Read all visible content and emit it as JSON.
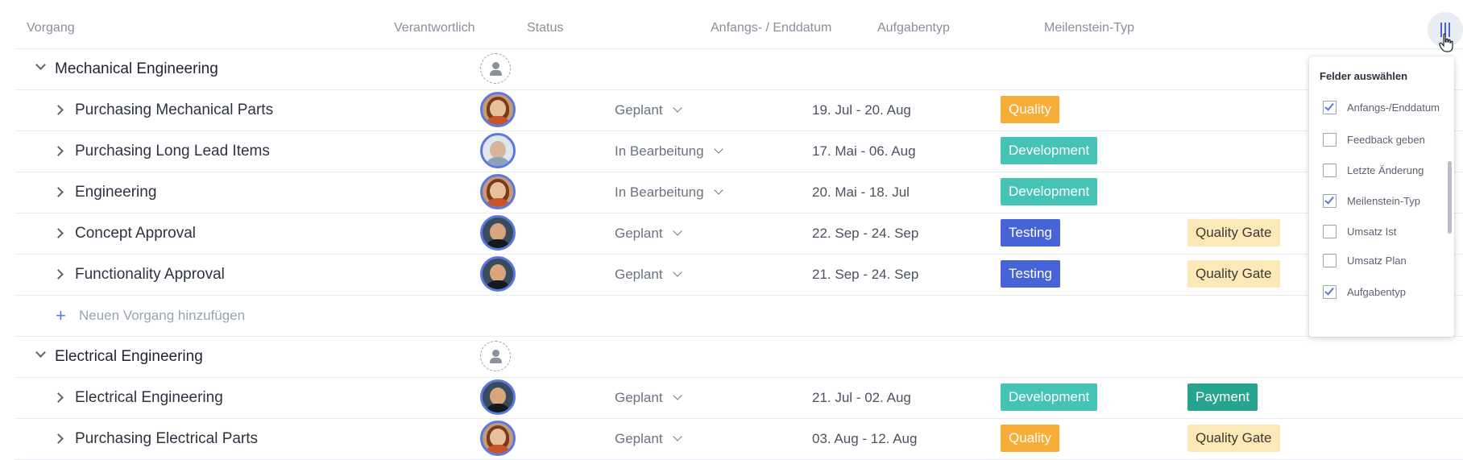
{
  "headers": {
    "vorgang": "Vorgang",
    "verantwortlich": "Verantwortlich",
    "status": "Status",
    "datum": "Anfangs- / Enddatum",
    "aufgabentyp": "Aufgabentyp",
    "meilenstein": "Meilenstein-Typ"
  },
  "groups": [
    {
      "title": "Mechanical Engineering",
      "tasks": [
        {
          "name": "Purchasing Mechanical Parts",
          "status": "Geplant",
          "dates": "19. Jul - 20. Aug",
          "type": "Quality",
          "milestone": ""
        },
        {
          "name": "Purchasing Long Lead Items",
          "status": "In Bearbeitung",
          "dates": "17. Mai - 06. Aug",
          "type": "Development",
          "milestone": ""
        },
        {
          "name": "Engineering",
          "status": "In Bearbeitung",
          "dates": "20. Mai - 18. Jul",
          "type": "Development",
          "milestone": ""
        },
        {
          "name": "Concept Approval",
          "status": "Geplant",
          "dates": "22. Sep - 24. Sep",
          "type": "Testing",
          "milestone": "Quality Gate"
        },
        {
          "name": "Functionality Approval",
          "status": "Geplant",
          "dates": "21. Sep - 24. Sep",
          "type": "Testing",
          "milestone": "Quality Gate"
        }
      ],
      "add_label": "Neuen Vorgang hinzufügen"
    },
    {
      "title": "Electrical Engineering",
      "tasks": [
        {
          "name": "Electrical Engineering",
          "status": "Geplant",
          "dates": "21. Jul - 02. Aug",
          "type": "Development",
          "milestone": "Payment"
        },
        {
          "name": "Purchasing Electrical Parts",
          "status": "Geplant",
          "dates": "03. Aug - 12. Aug",
          "type": "Quality",
          "milestone": "Quality Gate"
        }
      ]
    }
  ],
  "add_plus": "+",
  "field_panel": {
    "title": "Felder auswählen",
    "options": [
      {
        "label": "Anfangs-/Enddatum",
        "checked": true
      },
      {
        "label": "Feedback geben",
        "checked": false
      },
      {
        "label": "Letzte Änderung",
        "checked": false
      },
      {
        "label": "Meilenstein-Typ",
        "checked": true
      },
      {
        "label": "Umsatz Ist",
        "checked": false
      },
      {
        "label": "Umsatz Plan",
        "checked": false
      },
      {
        "label": "Aufgabentyp",
        "checked": true
      }
    ]
  },
  "colors": {
    "Quality": "#f7ad38",
    "Development": "#45c4b5",
    "Testing": "#4763d8",
    "Payment": "#26a48f",
    "Quality Gate": "#fde8b8",
    "accent": "#5b78e0"
  },
  "icons": {
    "expand": "chevron-down-icon",
    "collapse": "chevron-right-icon",
    "columns": "column-settings-icon",
    "placeholder": "user-placeholder-icon"
  }
}
